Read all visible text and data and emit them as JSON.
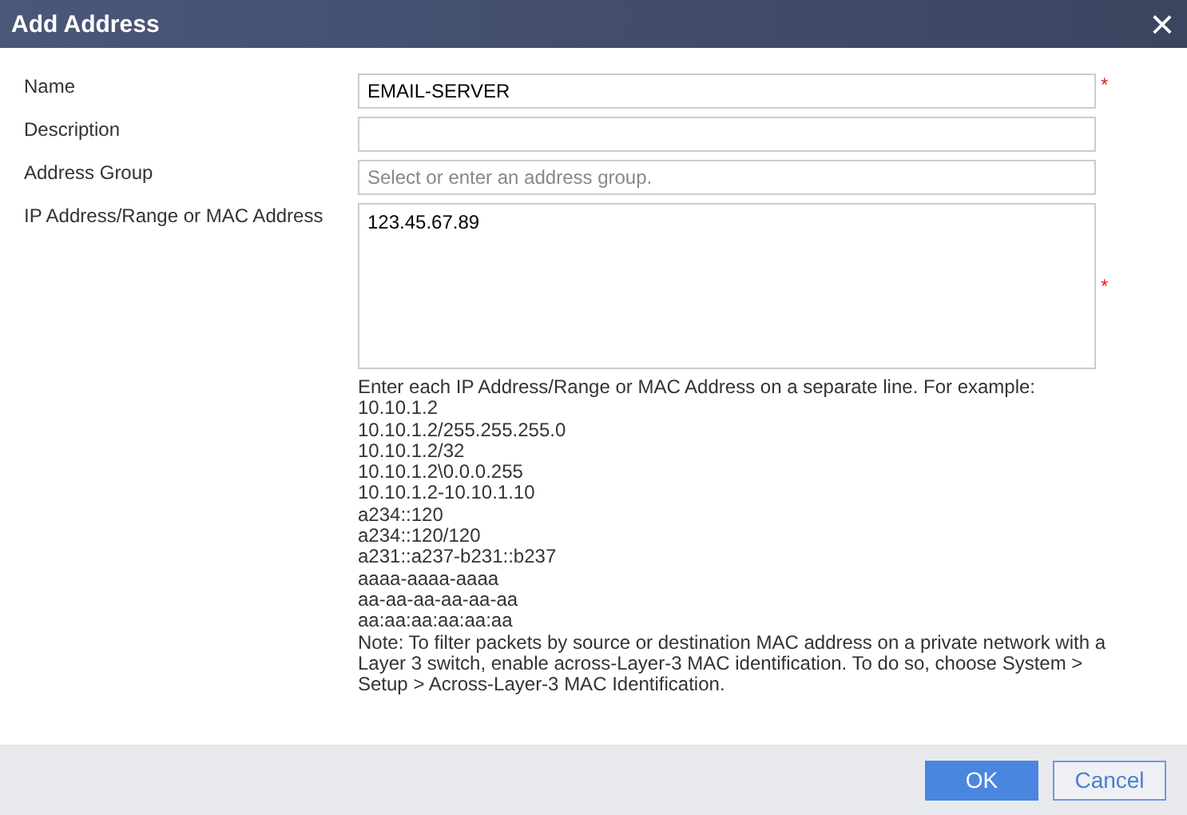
{
  "window": {
    "title": "Add Address",
    "close": "×"
  },
  "fields": [
    {
      "label": "Name",
      "kind": "text",
      "value": "EMAIL-SERVER",
      "required_mark": "*"
    },
    {
      "label": "Description",
      "kind": "text"
    },
    {
      "label": "Address Group",
      "kind": "text",
      "placeholder": "Select or enter an address group."
    },
    {
      "label": "IP Address/Range or MAC Address",
      "kind": "textarea",
      "value": "123.45.67.89",
      "required_mark": "*"
    }
  ],
  "help": {
    "intro": "Enter each IP Address/Range or MAC Address on a separate line. For example:",
    "examples": [
      "10.10.1.2",
      "10.10.1.2/255.255.255.0",
      "10.10.1.2/32",
      "10.10.1.2\\0.0.0.255",
      "10.10.1.2-10.10.1.10",
      "a234::120",
      "a234::120/120",
      "a231::a237-b231::b237",
      "aaaa-aaaa-aaaa",
      "aa-aa-aa-aa-aa-aa",
      "aa:aa:aa:aa:aa:aa"
    ],
    "note": "Note: To filter packets by source or destination MAC address on a private network with a Layer 3 switch, enable across-Layer-3 MAC identification. To do so, choose System > Setup > Across-Layer-3 MAC Identification."
  },
  "buttons": [
    {
      "label": "OK",
      "kind": "primary"
    },
    {
      "label": "Cancel",
      "kind": "secondary"
    }
  ]
}
